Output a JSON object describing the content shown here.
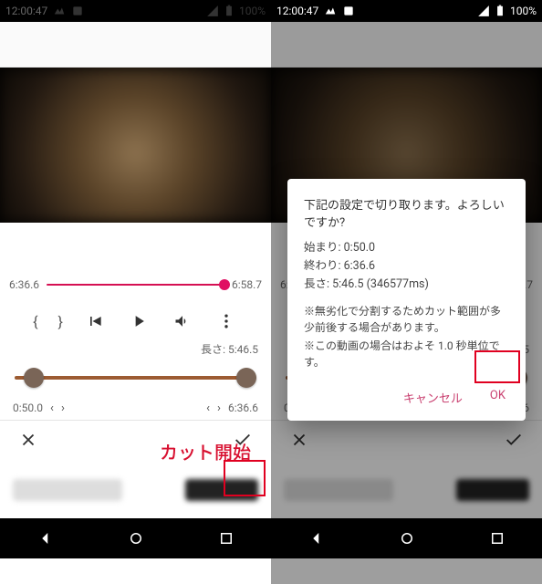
{
  "statusbar": {
    "time": "12:00:47",
    "battery": "100%"
  },
  "seek": {
    "start_time": "6:36.6",
    "end_time": "6:58.7"
  },
  "controls": {
    "brace_open": "{",
    "brace_close": "}"
  },
  "length_label": "長さ: 5:46.5",
  "range": {
    "start": "0:50.0",
    "end": "6:36.6"
  },
  "annotations": {
    "cut_start": "カット開始"
  },
  "dialog": {
    "title": "下記の設定で切り取ります。よろしいですか?",
    "line_start": "始まり: 0:50.0",
    "line_end": "終わり: 6:36.6",
    "line_len": "長さ: 5:46.5 (346577ms)",
    "note1": "※無劣化で分割するためカット範囲が多少前後する場合があります。",
    "note2": "※この動画の場合はおよそ 1.0 秒単位です。",
    "cancel": "キャンセル",
    "ok": "OK"
  }
}
